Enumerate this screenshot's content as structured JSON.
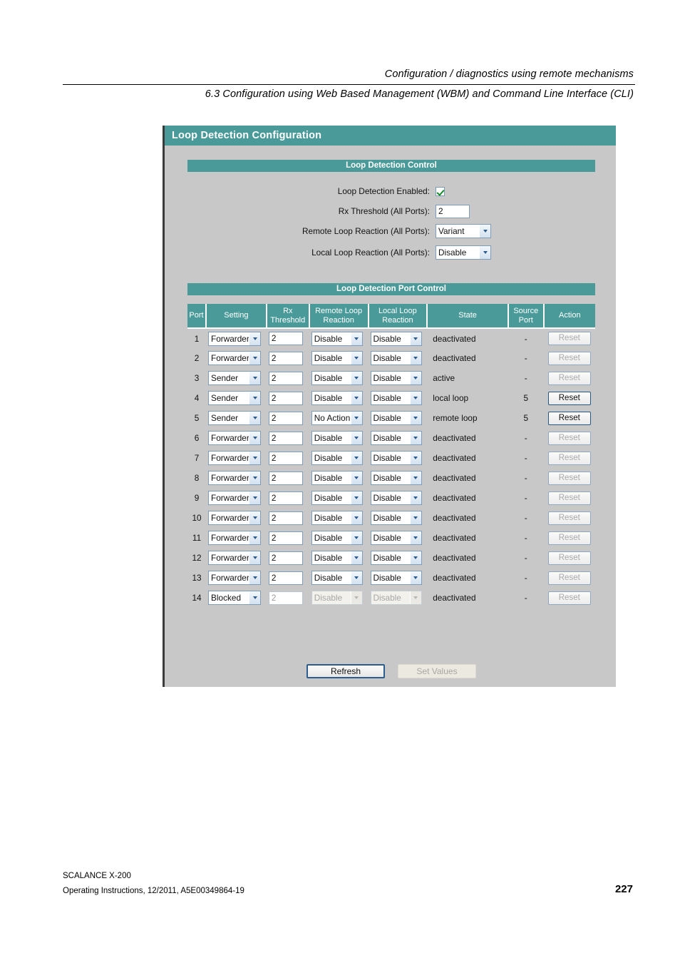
{
  "document": {
    "header_line1": "Configuration / diagnostics using remote mechanisms",
    "header_line2": "6.3 Configuration using Web Based Management (WBM) and Command Line Interface (CLI)",
    "footer_product": "SCALANCE X-200",
    "footer_doc": "Operating Instructions, 12/2011, A5E00349864-19",
    "page_number": "227"
  },
  "colors": {
    "teal": "#4a9a9a",
    "panel_bg": "#c8c8c8",
    "field_border": "#7f9db9",
    "check_green": "#128a2a"
  },
  "panel": {
    "title": "Loop Detection Configuration"
  },
  "control_section": {
    "title": "Loop Detection Control",
    "rows": [
      {
        "label": "Loop Detection Enabled:",
        "type": "checkbox",
        "value": "checked"
      },
      {
        "label": "Rx Threshold (All Ports):",
        "type": "text",
        "value": "2"
      },
      {
        "label": "Remote Loop Reaction (All Ports):",
        "type": "select",
        "value": "Variant"
      },
      {
        "label": "Local Loop Reaction (All Ports):",
        "type": "select",
        "value": "Disable"
      }
    ]
  },
  "port_section": {
    "title": "Loop Detection Port Control",
    "columns": [
      "Port",
      "Setting",
      "Rx Threshold",
      "Remote Loop Reaction",
      "Local Loop Reaction",
      "State",
      "Source Port",
      "Action"
    ],
    "columns_wrapped": [
      {
        "l1": "Port",
        "l2": ""
      },
      {
        "l1": "Setting",
        "l2": ""
      },
      {
        "l1": "Rx",
        "l2": "Threshold"
      },
      {
        "l1": "Remote Loop",
        "l2": "Reaction"
      },
      {
        "l1": "Local Loop",
        "l2": "Reaction"
      },
      {
        "l1": "State",
        "l2": ""
      },
      {
        "l1": "Source",
        "l2": "Port"
      },
      {
        "l1": "Action",
        "l2": ""
      }
    ],
    "rows": [
      {
        "port": "1",
        "setting": "Forwarder",
        "rx": "2",
        "remote": "Disable",
        "local": "Disable",
        "state": "deactivated",
        "source": "-",
        "action": "Reset",
        "action_enabled": false,
        "row_disabled": false
      },
      {
        "port": "2",
        "setting": "Forwarder",
        "rx": "2",
        "remote": "Disable",
        "local": "Disable",
        "state": "deactivated",
        "source": "-",
        "action": "Reset",
        "action_enabled": false,
        "row_disabled": false
      },
      {
        "port": "3",
        "setting": "Sender",
        "rx": "2",
        "remote": "Disable",
        "local": "Disable",
        "state": "active",
        "source": "-",
        "action": "Reset",
        "action_enabled": false,
        "row_disabled": false
      },
      {
        "port": "4",
        "setting": "Sender",
        "rx": "2",
        "remote": "Disable",
        "local": "Disable",
        "state": "local loop",
        "source": "5",
        "action": "Reset",
        "action_enabled": true,
        "row_disabled": false
      },
      {
        "port": "5",
        "setting": "Sender",
        "rx": "2",
        "remote": "No Action",
        "local": "Disable",
        "state": "remote loop",
        "source": "5",
        "action": "Reset",
        "action_enabled": true,
        "row_disabled": false
      },
      {
        "port": "6",
        "setting": "Forwarder",
        "rx": "2",
        "remote": "Disable",
        "local": "Disable",
        "state": "deactivated",
        "source": "-",
        "action": "Reset",
        "action_enabled": false,
        "row_disabled": false
      },
      {
        "port": "7",
        "setting": "Forwarder",
        "rx": "2",
        "remote": "Disable",
        "local": "Disable",
        "state": "deactivated",
        "source": "-",
        "action": "Reset",
        "action_enabled": false,
        "row_disabled": false
      },
      {
        "port": "8",
        "setting": "Forwarder",
        "rx": "2",
        "remote": "Disable",
        "local": "Disable",
        "state": "deactivated",
        "source": "-",
        "action": "Reset",
        "action_enabled": false,
        "row_disabled": false
      },
      {
        "port": "9",
        "setting": "Forwarder",
        "rx": "2",
        "remote": "Disable",
        "local": "Disable",
        "state": "deactivated",
        "source": "-",
        "action": "Reset",
        "action_enabled": false,
        "row_disabled": false
      },
      {
        "port": "10",
        "setting": "Forwarder",
        "rx": "2",
        "remote": "Disable",
        "local": "Disable",
        "state": "deactivated",
        "source": "-",
        "action": "Reset",
        "action_enabled": false,
        "row_disabled": false
      },
      {
        "port": "11",
        "setting": "Forwarder",
        "rx": "2",
        "remote": "Disable",
        "local": "Disable",
        "state": "deactivated",
        "source": "-",
        "action": "Reset",
        "action_enabled": false,
        "row_disabled": false
      },
      {
        "port": "12",
        "setting": "Forwarder",
        "rx": "2",
        "remote": "Disable",
        "local": "Disable",
        "state": "deactivated",
        "source": "-",
        "action": "Reset",
        "action_enabled": false,
        "row_disabled": false
      },
      {
        "port": "13",
        "setting": "Forwarder",
        "rx": "2",
        "remote": "Disable",
        "local": "Disable",
        "state": "deactivated",
        "source": "-",
        "action": "Reset",
        "action_enabled": false,
        "row_disabled": false
      },
      {
        "port": "14",
        "setting": "Blocked",
        "rx": "2",
        "remote": "Disable",
        "local": "Disable",
        "state": "deactivated",
        "source": "-",
        "action": "Reset",
        "action_enabled": false,
        "row_disabled": true
      }
    ]
  },
  "footer_buttons": {
    "refresh": "Refresh",
    "set_values": "Set Values"
  }
}
